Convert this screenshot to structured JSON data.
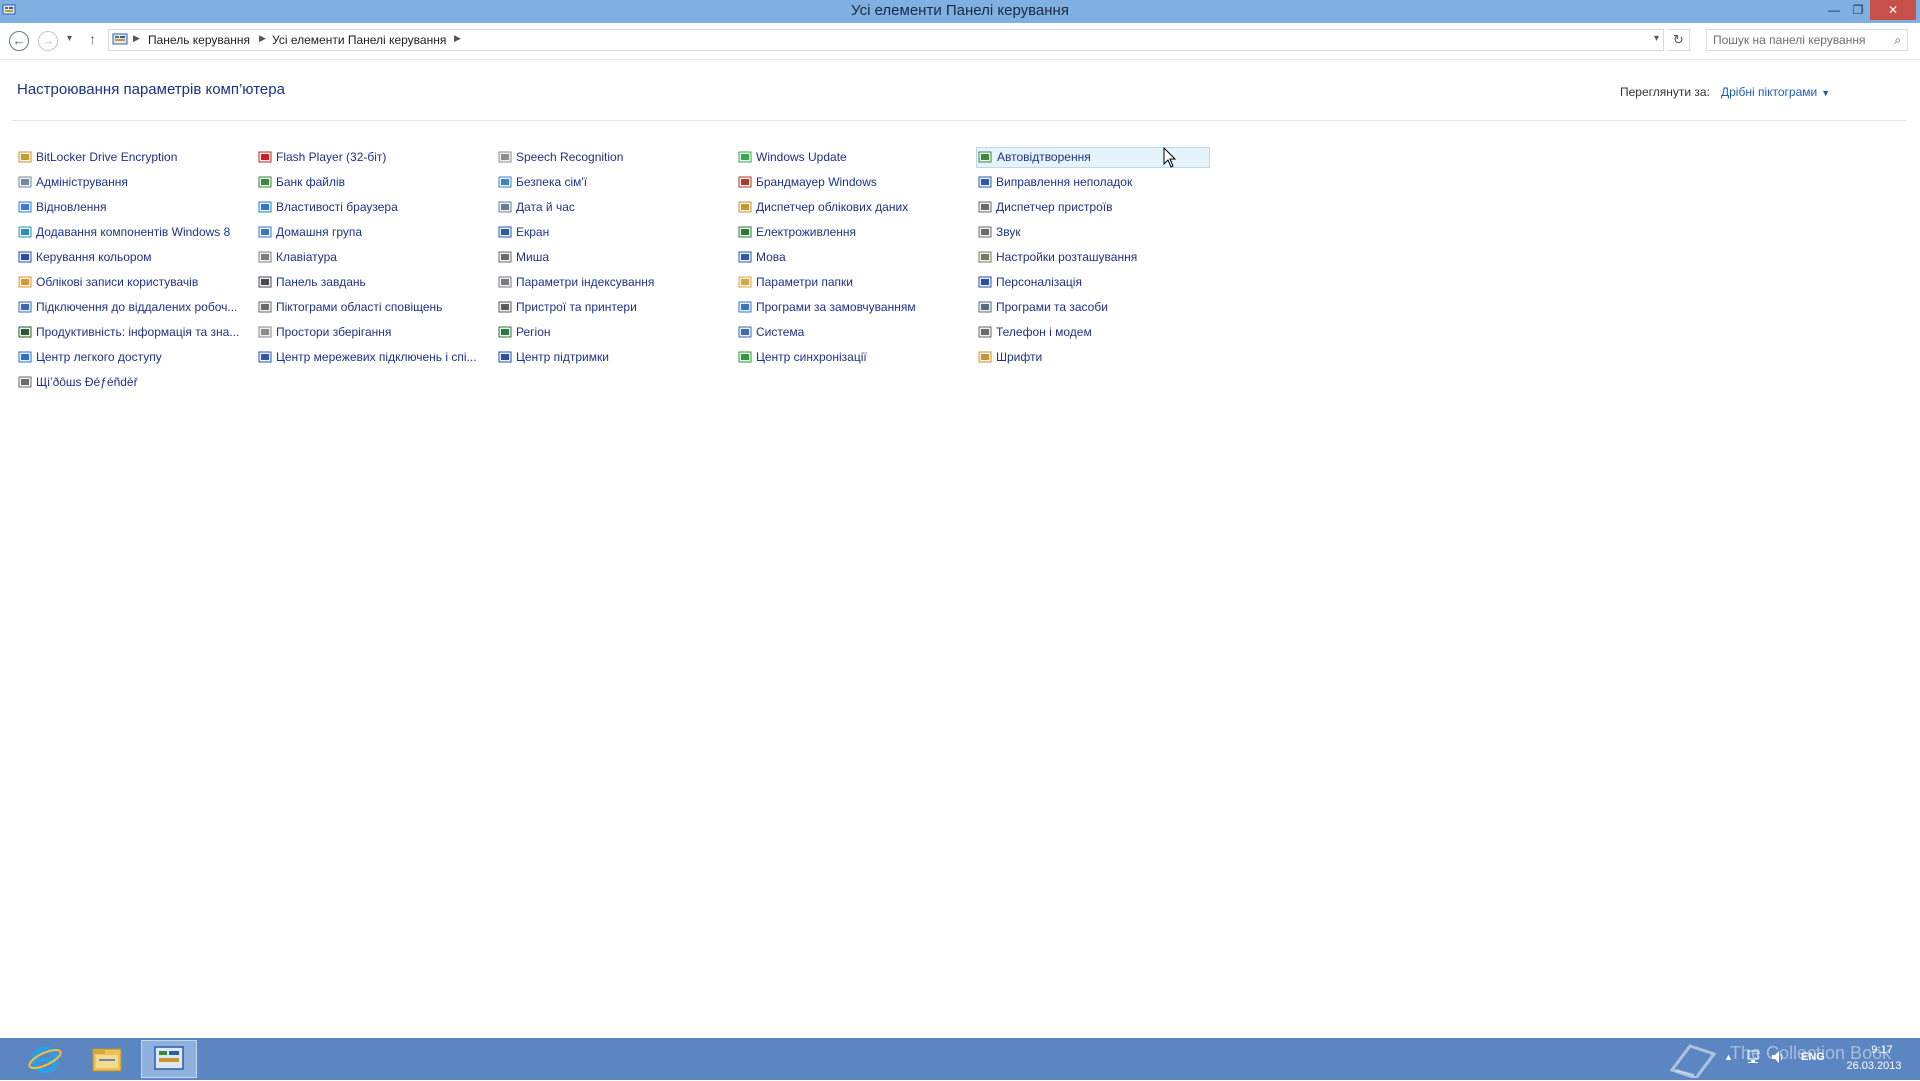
{
  "window": {
    "title": "Усі елементи Панелі керування",
    "min_glyph": "—",
    "max_glyph": "❐",
    "close_glyph": "✕"
  },
  "address": {
    "crumbs": [
      "Панель керування",
      "Усі елементи Панелі керування"
    ],
    "search_placeholder": "Пошук на панелі керування"
  },
  "header": {
    "title": "Настроювання параметрів комп’ютера",
    "view_by_label": "Переглянути за:",
    "view_by_value": "Дрібні піктограми"
  },
  "columns": [
    [
      {
        "label": "BitLocker Drive Encryption",
        "icon": "bitlocker-icon",
        "color": "#c79a2a"
      },
      {
        "label": "Адміністрування",
        "icon": "administrative-tools-icon",
        "color": "#7a8a9a"
      },
      {
        "label": "Відновлення",
        "icon": "recovery-icon",
        "color": "#3a7bd5"
      },
      {
        "label": "Додавання компонентів Windows 8",
        "icon": "add-features-icon",
        "color": "#2d8fb8"
      },
      {
        "label": "Керування кольором",
        "icon": "color-management-icon",
        "color": "#2c4fa3"
      },
      {
        "label": "Облікові записи користувачів",
        "icon": "user-accounts-icon",
        "color": "#d89b2a"
      },
      {
        "label": "Підключення до віддалених робоч...",
        "icon": "remote-desktop-icon",
        "color": "#3a6bb0"
      },
      {
        "label": "Продуктивність: інформація та зна...",
        "icon": "performance-icon",
        "color": "#2f5a2f"
      },
      {
        "label": "Центр легкого доступу",
        "icon": "ease-of-access-icon",
        "color": "#2f6fc9"
      },
      {
        "label": "Щі’ðôшs Ðéƒéñdéř",
        "icon": "windows-defender-icon",
        "color": "#6b6b6b"
      }
    ],
    [
      {
        "label": "Flash Player (32-біт)",
        "icon": "flash-player-icon",
        "color": "#c8221e"
      },
      {
        "label": "Банк файлів",
        "icon": "file-history-icon",
        "color": "#3b8a3b"
      },
      {
        "label": "Властивості браузера",
        "icon": "internet-options-icon",
        "color": "#2a7bc2"
      },
      {
        "label": "Домашня група",
        "icon": "homegroup-icon",
        "color": "#3a74c4"
      },
      {
        "label": "Клавіатура",
        "icon": "keyboard-icon",
        "color": "#7c7c7c"
      },
      {
        "label": "Панель завдань",
        "icon": "taskbar-icon",
        "color": "#4a4a4a"
      },
      {
        "label": "Піктограми області сповіщень",
        "icon": "notification-icons-icon",
        "color": "#6a6a6a"
      },
      {
        "label": "Простори зберігання",
        "icon": "storage-spaces-icon",
        "color": "#8a8a8a"
      },
      {
        "label": "Центр мережевих підключень і спі...",
        "icon": "network-center-icon",
        "color": "#2c5aa8"
      }
    ],
    [
      {
        "label": "Speech Recognition",
        "icon": "speech-recognition-icon",
        "color": "#8d8d8d"
      },
      {
        "label": "Безпека сім'ї",
        "icon": "family-safety-icon",
        "color": "#3a86c8"
      },
      {
        "label": "Дата й час",
        "icon": "date-time-icon",
        "color": "#6a7d90"
      },
      {
        "label": "Екран",
        "icon": "display-icon",
        "color": "#2c5aa8"
      },
      {
        "label": "Миша",
        "icon": "mouse-icon",
        "color": "#6a6a6a"
      },
      {
        "label": "Параметри індексування",
        "icon": "indexing-icon",
        "color": "#7a7a7a"
      },
      {
        "label": "Пристрої та принтери",
        "icon": "devices-printers-icon",
        "color": "#5a5a5a"
      },
      {
        "label": "Регіон",
        "icon": "region-icon",
        "color": "#2e7a3a"
      },
      {
        "label": "Центр підтримки",
        "icon": "action-center-icon",
        "color": "#2c4fa3"
      }
    ],
    [
      {
        "label": "Windows Update",
        "icon": "windows-update-icon",
        "color": "#3aa84a"
      },
      {
        "label": "Брандмауер Windows",
        "icon": "firewall-icon",
        "color": "#b03a2a"
      },
      {
        "label": "Диспетчер облікових даних",
        "icon": "credential-manager-icon",
        "color": "#c8962a"
      },
      {
        "label": "Електроживлення",
        "icon": "power-options-icon",
        "color": "#2f7a2f"
      },
      {
        "label": "Мова",
        "icon": "language-icon",
        "color": "#2c5aa8"
      },
      {
        "label": "Параметри папки",
        "icon": "folder-options-icon",
        "color": "#d7a83a"
      },
      {
        "label": "Програми за замовчуванням",
        "icon": "default-programs-icon",
        "color": "#3a74c4"
      },
      {
        "label": "Система",
        "icon": "system-icon",
        "color": "#3a6bb0"
      },
      {
        "label": "Центр синхронізації",
        "icon": "sync-center-icon",
        "color": "#2e9a3a"
      }
    ],
    [
      {
        "label": "Автовідтворення",
        "icon": "autoplay-icon",
        "color": "#3a8a3a"
      },
      {
        "label": "Виправлення неполадок",
        "icon": "troubleshooting-icon",
        "color": "#2c5aa8"
      },
      {
        "label": "Диспетчер пристроїв",
        "icon": "device-manager-icon",
        "color": "#6a6a6a"
      },
      {
        "label": "Звук",
        "icon": "sound-icon",
        "color": "#6a6a6a"
      },
      {
        "label": "Настройки розташування",
        "icon": "location-settings-icon",
        "color": "#7a7a5a"
      },
      {
        "label": "Персоналізація",
        "icon": "personalization-icon",
        "color": "#2c4fa3"
      },
      {
        "label": "Програми та засоби",
        "icon": "programs-features-icon",
        "color": "#5a6a7a"
      },
      {
        "label": "Телефон і модем",
        "icon": "phone-modem-icon",
        "color": "#6a6a6a"
      },
      {
        "label": "Шрифти",
        "icon": "fonts-icon",
        "color": "#c8962a"
      }
    ]
  ],
  "hovered_item": "Автовідтворення",
  "taskbar": {
    "pinned": [
      "internet-explorer-icon",
      "file-explorer-icon",
      "control-panel-icon"
    ],
    "language": "ENG",
    "time": "9:17",
    "date": "26.03.2013",
    "watermark": "The Collection Book"
  }
}
